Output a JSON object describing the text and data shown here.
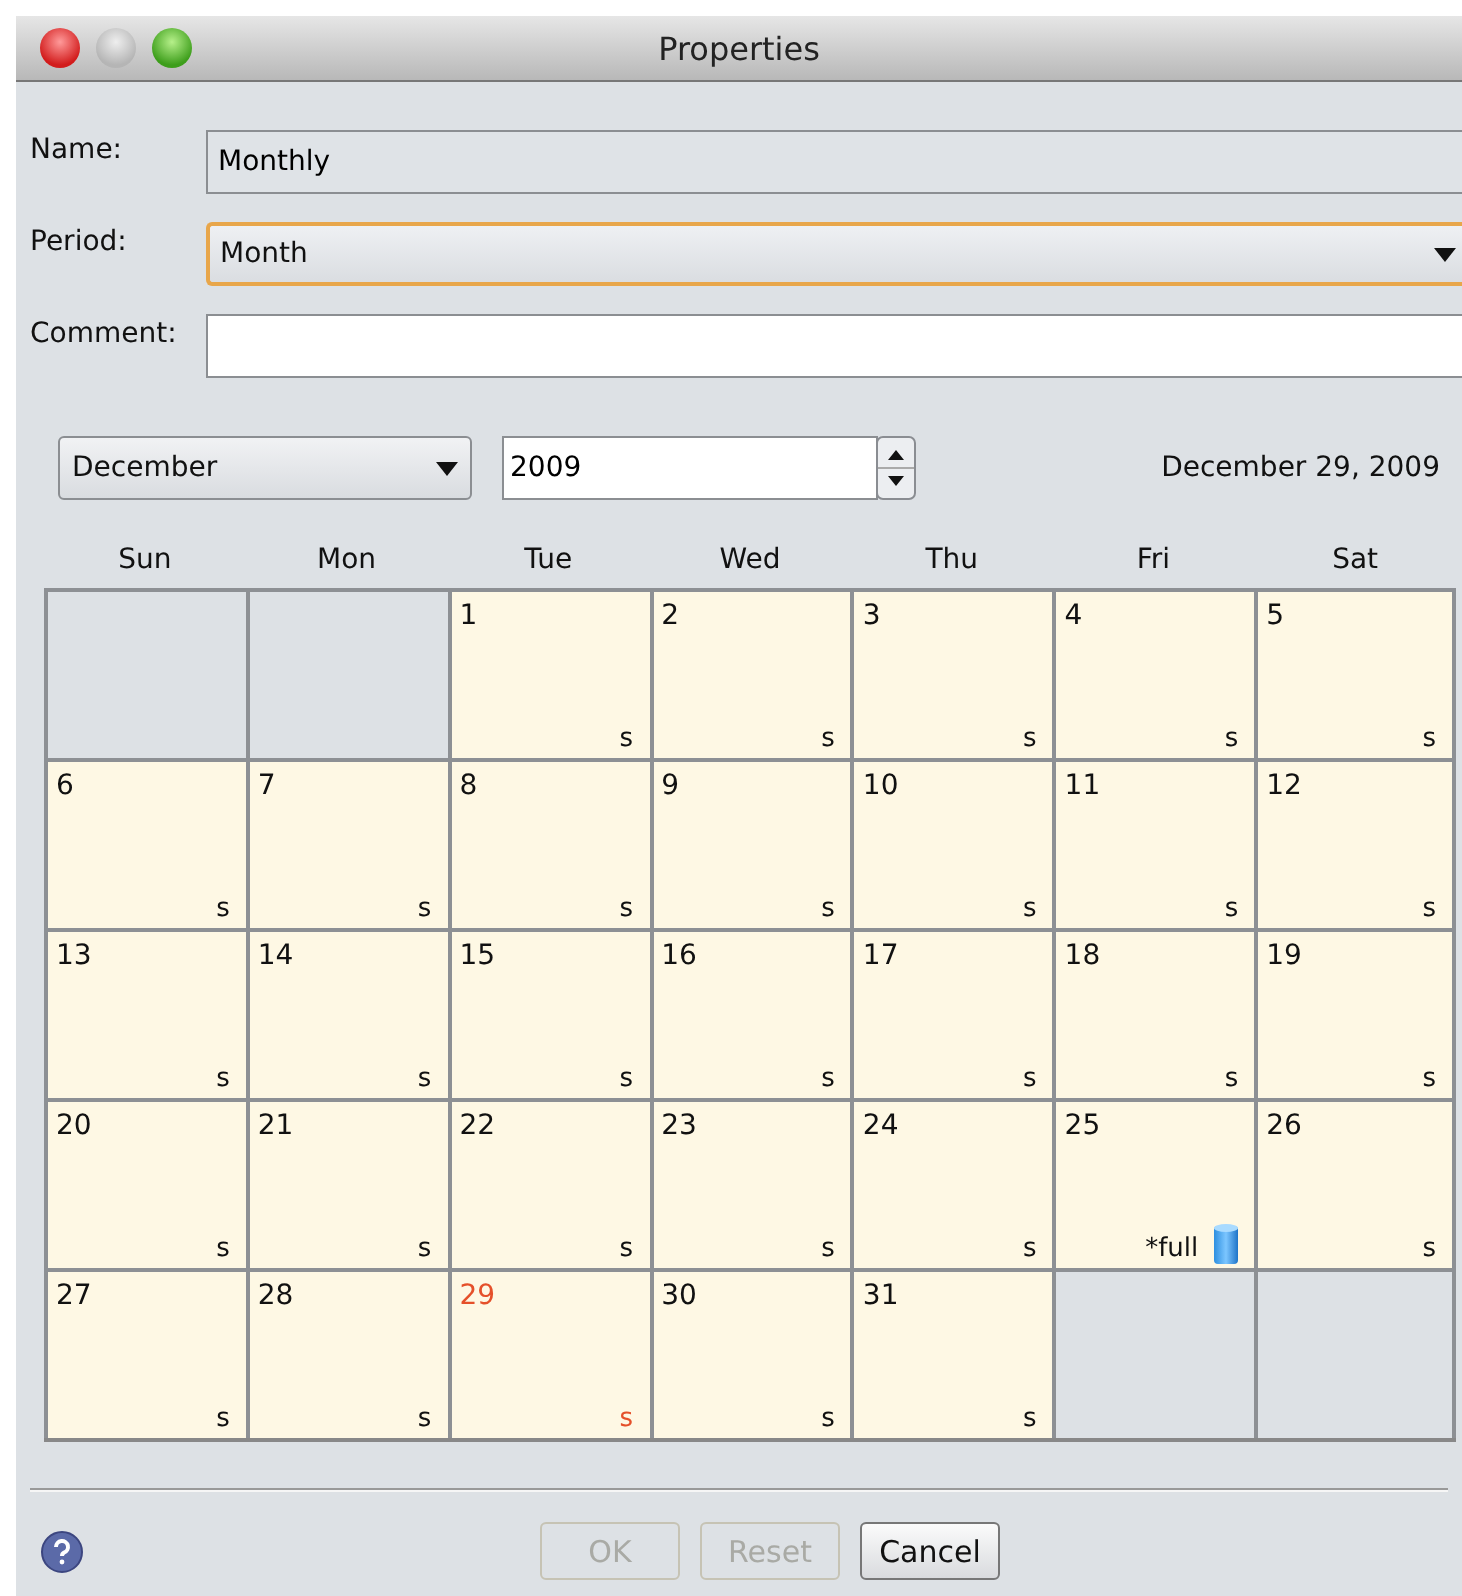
{
  "window": {
    "title": "Properties"
  },
  "fields": [
    {
      "kind": "text",
      "label": "Name:",
      "value": "Monthly",
      "editable": false
    },
    {
      "kind": "dropdown",
      "label": "Period:",
      "value": "Month",
      "focused": true
    },
    {
      "kind": "text",
      "label": "Comment:",
      "editable": true
    }
  ],
  "month_picker": {
    "value": "December"
  },
  "year_spinner": {
    "value": "2009"
  },
  "selected_date": "December 29, 2009",
  "weekdays": [
    "Sun",
    "Mon",
    "Tue",
    "Wed",
    "Thu",
    "Fri",
    "Sat"
  ],
  "weeks": [
    [
      {
        "kind": "empty"
      },
      {
        "kind": "empty"
      },
      {
        "kind": "day",
        "day": "1",
        "tag": "s",
        "today": false
      },
      {
        "kind": "day",
        "day": "2",
        "tag": "s",
        "today": false
      },
      {
        "kind": "day",
        "day": "3",
        "tag": "s",
        "today": false
      },
      {
        "kind": "day",
        "day": "4",
        "tag": "s",
        "today": false
      },
      {
        "kind": "day",
        "day": "5",
        "tag": "s",
        "today": false
      }
    ],
    [
      {
        "kind": "day",
        "day": "6",
        "tag": "s",
        "today": false
      },
      {
        "kind": "day",
        "day": "7",
        "tag": "s",
        "today": false
      },
      {
        "kind": "day",
        "day": "8",
        "tag": "s",
        "today": false
      },
      {
        "kind": "day",
        "day": "9",
        "tag": "s",
        "today": false
      },
      {
        "kind": "day",
        "day": "10",
        "tag": "s",
        "today": false
      },
      {
        "kind": "day",
        "day": "11",
        "tag": "s",
        "today": false
      },
      {
        "kind": "day",
        "day": "12",
        "tag": "s",
        "today": false
      }
    ],
    [
      {
        "kind": "day",
        "day": "13",
        "tag": "s",
        "today": false
      },
      {
        "kind": "day",
        "day": "14",
        "tag": "s",
        "today": false
      },
      {
        "kind": "day",
        "day": "15",
        "tag": "s",
        "today": false
      },
      {
        "kind": "day",
        "day": "16",
        "tag": "s",
        "today": false
      },
      {
        "kind": "day",
        "day": "17",
        "tag": "s",
        "today": false
      },
      {
        "kind": "day",
        "day": "18",
        "tag": "s",
        "today": false
      },
      {
        "kind": "day",
        "day": "19",
        "tag": "s",
        "today": false
      }
    ],
    [
      {
        "kind": "day",
        "day": "20",
        "tag": "s",
        "today": false
      },
      {
        "kind": "day",
        "day": "21",
        "tag": "s",
        "today": false
      },
      {
        "kind": "day",
        "day": "22",
        "tag": "s",
        "today": false
      },
      {
        "kind": "day",
        "day": "23",
        "tag": "s",
        "today": false
      },
      {
        "kind": "day",
        "day": "24",
        "tag": "s",
        "today": false
      },
      {
        "kind": "full",
        "day": "25",
        "tag": "*full",
        "today": false
      },
      {
        "kind": "day",
        "day": "26",
        "tag": "s",
        "today": false
      }
    ],
    [
      {
        "kind": "day",
        "day": "27",
        "tag": "s",
        "today": false
      },
      {
        "kind": "day",
        "day": "28",
        "tag": "s",
        "today": false
      },
      {
        "kind": "day",
        "day": "29",
        "tag": "s",
        "today": true
      },
      {
        "kind": "day",
        "day": "30",
        "tag": "s",
        "today": false
      },
      {
        "kind": "day",
        "day": "31",
        "tag": "s",
        "today": false
      },
      {
        "kind": "empty"
      },
      {
        "kind": "empty"
      }
    ]
  ],
  "buttons": [
    {
      "label": "OK",
      "disabled": true
    },
    {
      "label": "Reset",
      "disabled": true
    },
    {
      "label": "Cancel",
      "disabled": false
    }
  ]
}
